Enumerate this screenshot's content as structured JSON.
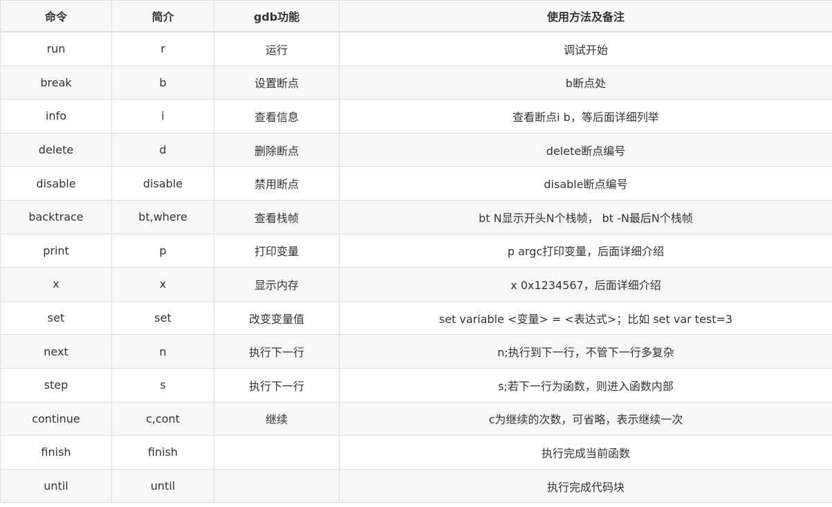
{
  "headers": [
    "命令",
    "简介",
    "gdb功能",
    "使用方法及备注"
  ],
  "rows": [
    [
      "run",
      "r",
      "运行",
      "调试开始"
    ],
    [
      "break",
      "b",
      "设置断点",
      "b断点处"
    ],
    [
      "info",
      "i",
      "查看信息",
      "查看断点i b，等后面详细列举"
    ],
    [
      "delete",
      "d",
      "删除断点",
      "delete断点编号"
    ],
    [
      "disable",
      "disable",
      "禁用断点",
      "disable断点编号"
    ],
    [
      "backtrace",
      "bt,where",
      "查看栈帧",
      "bt N显示开头N个栈帧， bt -N最后N个栈帧"
    ],
    [
      "print",
      "p",
      "打印变量",
      "p argc打印变量，后面详细介绍"
    ],
    [
      "x",
      "x",
      "显示内存",
      "x 0x1234567，后面详细介绍"
    ],
    [
      "set",
      "set",
      "改变变量值",
      "set variable <变量> = <表达式>；比如 set var test=3"
    ],
    [
      "next",
      "n",
      "执行下一行",
      "n;执行到下一行，不管下一行多复杂"
    ],
    [
      "step",
      "s",
      "执行下一行",
      "s;若下一行为函数，则进入函数内部"
    ],
    [
      "continue",
      "c,cont",
      "继续",
      "c为继续的次数，可省略，表示继续一次"
    ],
    [
      "finish",
      "finish",
      "",
      "执行完成当前函数"
    ],
    [
      "until",
      "until",
      "",
      "执行完成代码块"
    ]
  ]
}
